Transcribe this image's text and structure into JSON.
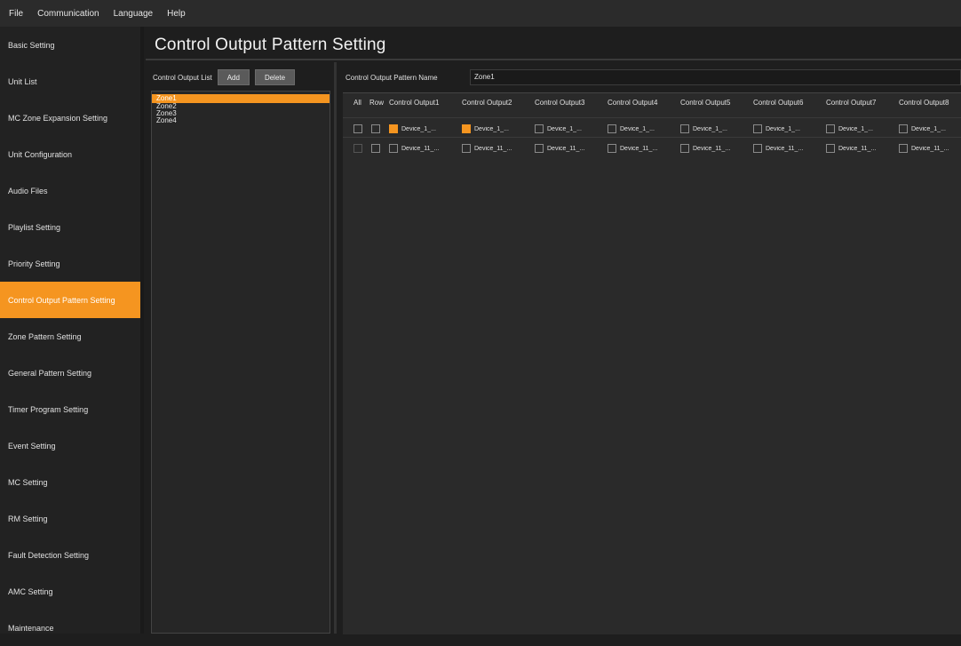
{
  "menu": [
    "File",
    "Communication",
    "Language",
    "Help"
  ],
  "nav": {
    "items": [
      "Basic Setting",
      "Unit List",
      "MC Zone Expansion Setting",
      "Unit Configuration",
      "Audio Files",
      "Playlist Setting",
      "Priority Setting",
      "Control Output Pattern Setting",
      "Zone Pattern Setting",
      "General Pattern Setting",
      "Timer Program Setting",
      "Event Setting",
      "MC Setting",
      "RM Setting",
      "Fault Detection Setting",
      "AMC Setting",
      "Maintenance"
    ],
    "active_index": 7
  },
  "page_title": "Control Output Pattern Setting",
  "list_panel": {
    "label": "Control Output List",
    "add_label": "Add",
    "delete_label": "Delete",
    "items": [
      "Zone1",
      "Zone2",
      "Zone3",
      "Zone4"
    ],
    "selected_index": 0
  },
  "pattern": {
    "name_label": "Control Output Pattern Name",
    "name_value": "Zone1",
    "col_all": "All",
    "col_row": "Row",
    "columns": [
      "Control Output1",
      "Control Output2",
      "Control Output3",
      "Control Output4",
      "Control Output5",
      "Control Output6",
      "Control Output7",
      "Control Output8"
    ],
    "rows": [
      {
        "cells": [
          {
            "label": "Device_1_...",
            "checked": true
          },
          {
            "label": "Device_1_...",
            "checked": true
          },
          {
            "label": "Device_1_...",
            "checked": false
          },
          {
            "label": "Device_1_...",
            "checked": false
          },
          {
            "label": "Device_1_...",
            "checked": false
          },
          {
            "label": "Device_1_...",
            "checked": false
          },
          {
            "label": "Device_1_...",
            "checked": false
          },
          {
            "label": "Device_1_...",
            "checked": false
          }
        ]
      },
      {
        "cells": [
          {
            "label": "Device_11_...",
            "checked": false
          },
          {
            "label": "Device_11_...",
            "checked": false
          },
          {
            "label": "Device_11_...",
            "checked": false
          },
          {
            "label": "Device_11_...",
            "checked": false
          },
          {
            "label": "Device_11_...",
            "checked": false
          },
          {
            "label": "Device_11_...",
            "checked": false
          },
          {
            "label": "Device_11_...",
            "checked": false
          },
          {
            "label": "Device_11_...",
            "checked": false
          }
        ]
      }
    ]
  },
  "colors": {
    "accent": "#f59520",
    "background": "#1e1e1e"
  }
}
